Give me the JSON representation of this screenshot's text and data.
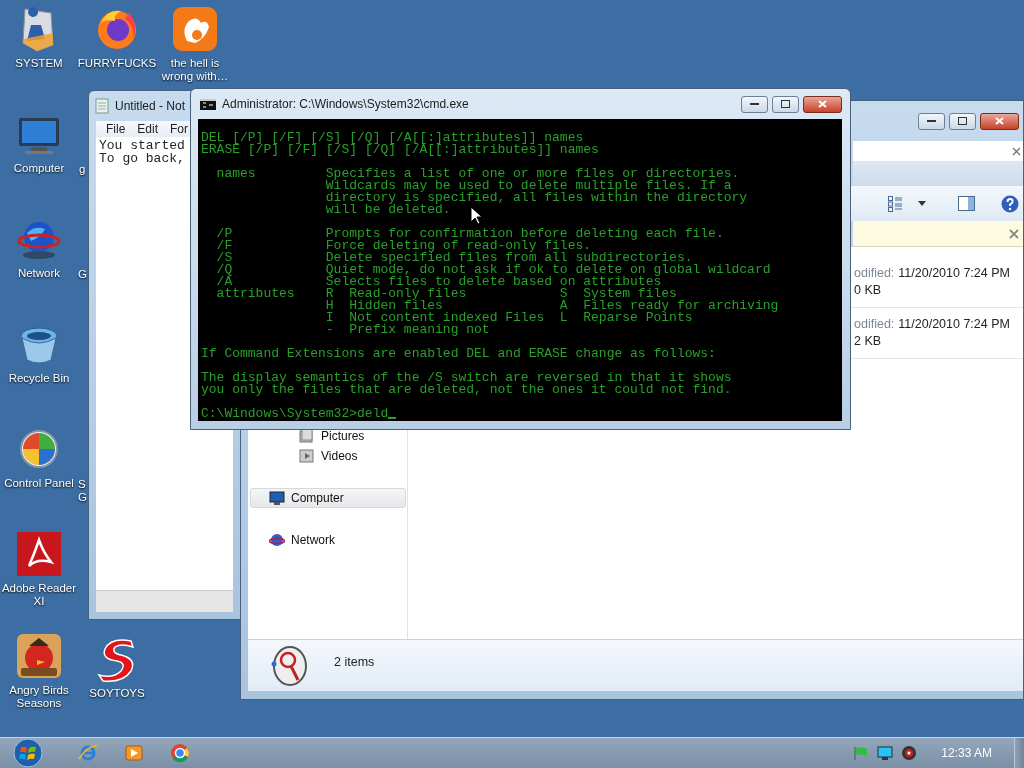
{
  "desktop_icons": [
    {
      "label": "SYSTEM",
      "kind": "shield"
    },
    {
      "label": "Computer",
      "kind": "computer"
    },
    {
      "label": "Network",
      "kind": "network"
    },
    {
      "label": "Recycle Bin",
      "kind": "bin"
    },
    {
      "label": "Control Panel",
      "kind": "control"
    },
    {
      "label": "Adobe Reader XI",
      "kind": "pdf"
    },
    {
      "label": "Angry Birds Seasons",
      "kind": "bird"
    },
    {
      "label": "FURRYFUCKS",
      "kind": "firefox"
    },
    {
      "label": "SOYTOYS",
      "kind": "swoosh"
    },
    {
      "label": "the hell is wrong with…",
      "kind": "squirrel"
    }
  ],
  "hidden_label_fragments": [
    "g",
    "G",
    "S\nG"
  ],
  "notepad": {
    "title": "Untitled - Not",
    "menu": [
      "File",
      "Edit",
      "For"
    ],
    "lines": [
      "You started",
      "To go back,"
    ]
  },
  "explorer": {
    "nav_children": [
      {
        "label": "Pictures",
        "kind": "pictures",
        "selected": false
      },
      {
        "label": "Videos",
        "kind": "videos",
        "selected": false
      }
    ],
    "nav_items": [
      {
        "label": "Computer",
        "kind": "computer",
        "selected": true
      },
      {
        "label": "Network",
        "kind": "network",
        "selected": false
      }
    ],
    "files": [
      {
        "modified_label": "odified:",
        "modified": "11/20/2010 7:24 PM",
        "size": "0 KB"
      },
      {
        "modified_label": "odified:",
        "modified": "11/20/2010 7:24 PM",
        "size": "2 KB"
      }
    ],
    "status": "2 items"
  },
  "cmd": {
    "title": "Administrator: C:\\Windows\\System32\\cmd.exe",
    "blocks": [
      [
        "DEL [/P] [/F] [/S] [/Q] [/A[[:]attributes]] names",
        "ERASE [/P] [/F] [/S] [/Q] [/A[[:]attributes]] names"
      ],
      [
        "  names         Specifies a list of one or more files or directories.",
        "                Wildcards may be used to delete multiple files. If a",
        "                directory is specified, all files within the directory",
        "                will be deleted."
      ],
      [
        "  /P            Prompts for confirmation before deleting each file.",
        "  /F            Force deleting of read-only files.",
        "  /S            Delete specified files from all subdirectories.",
        "  /Q            Quiet mode, do not ask if ok to delete on global wildcard",
        "  /A            Selects files to delete based on attributes",
        "  attributes    R  Read-only files            S  System files",
        "                H  Hidden files               A  Files ready for archiving",
        "                I  Not content indexed Files  L  Reparse Points",
        "                -  Prefix meaning not"
      ],
      [
        "If Command Extensions are enabled DEL and ERASE change as follows:"
      ],
      [
        "The display semantics of the /S switch are reversed in that it shows",
        "you only the files that are deleted, not the ones it could not find."
      ]
    ],
    "prompt": "C:\\Windows\\System32>deld"
  },
  "taskbar": {
    "pinned": [
      {
        "kind": "ie"
      },
      {
        "kind": "media"
      },
      {
        "kind": "chrome"
      }
    ],
    "tray": [
      {
        "kind": "flag"
      },
      {
        "kind": "monitor"
      },
      {
        "kind": "speaker"
      }
    ],
    "clock": "12:33 AM"
  }
}
